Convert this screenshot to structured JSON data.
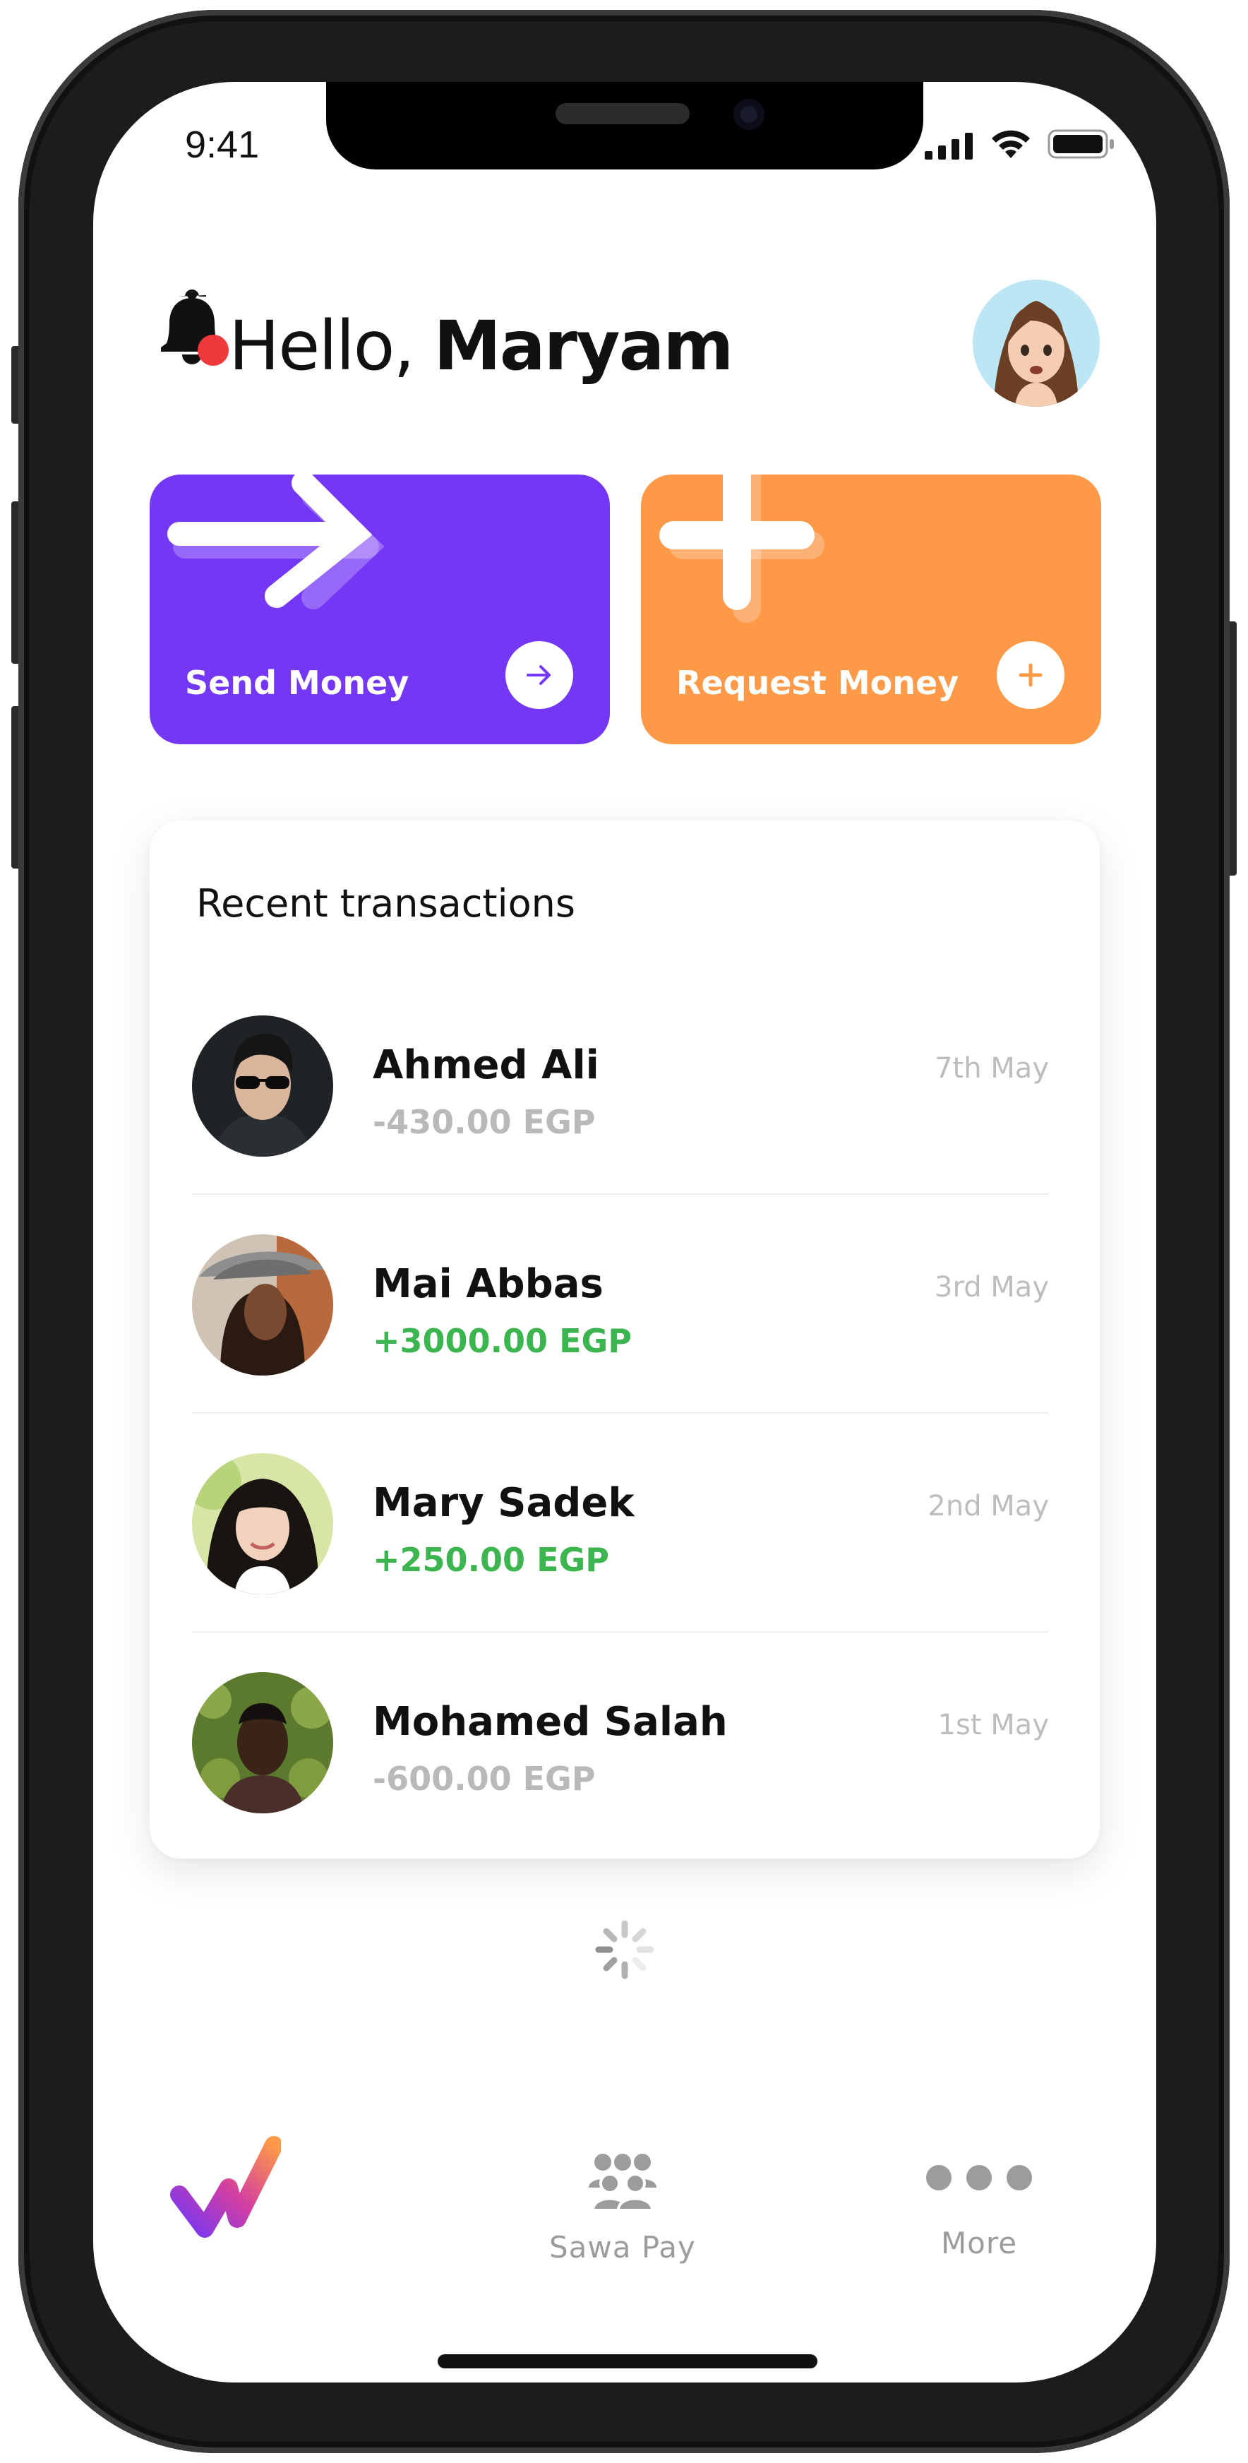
{
  "status_bar": {
    "time": "9:41"
  },
  "header": {
    "greeting": "Hello,",
    "user_name": "Maryam"
  },
  "actions": {
    "send": {
      "label": "Send Money",
      "color": "#7437f6"
    },
    "request": {
      "label": "Request Money",
      "color": "#fd9947"
    }
  },
  "transactions": {
    "title": "Recent transactions",
    "items": [
      {
        "name": "Ahmed Ali",
        "amount": "-430.00 EGP",
        "date": "7th May",
        "direction": "out"
      },
      {
        "name": "Mai Abbas",
        "amount": "+3000.00 EGP",
        "date": "3rd May",
        "direction": "in"
      },
      {
        "name": "Mary  Sadek",
        "amount": "+250.00 EGP",
        "date": "2nd May",
        "direction": "in"
      },
      {
        "name": "Mohamed Salah",
        "amount": "-600.00 EGP",
        "date": "1st May",
        "direction": "out"
      }
    ]
  },
  "tab_bar": {
    "items": [
      {
        "icon": "app-logo-icon",
        "label": ""
      },
      {
        "icon": "group-icon",
        "label": "Sawa Pay"
      },
      {
        "icon": "more-dots-icon",
        "label": "More"
      }
    ]
  },
  "colors": {
    "positive": "#3cb44f",
    "negative": "#b9b9b9",
    "notification_dot": "#f0393c"
  }
}
